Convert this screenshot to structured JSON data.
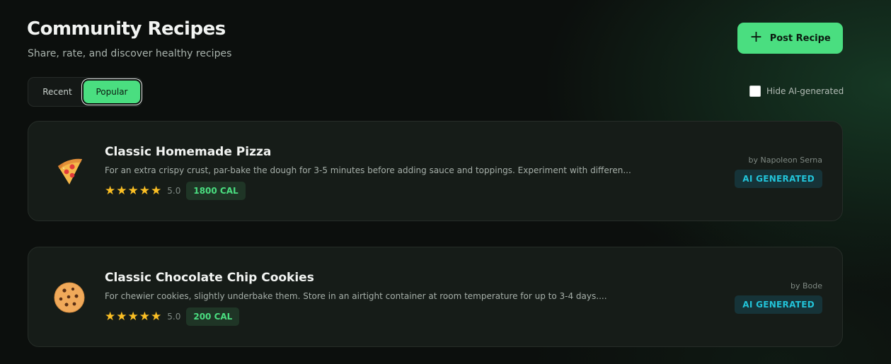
{
  "header": {
    "title": "Community Recipes",
    "subtitle": "Share, rate, and discover healthy recipes",
    "post_button_label": "Post Recipe"
  },
  "tabs": {
    "recent": "Recent",
    "popular": "Popular",
    "active": "Popular"
  },
  "filter": {
    "hide_ai_label": "Hide AI-generated",
    "hide_ai_checked": false
  },
  "recipes": [
    {
      "icon": "pizza-icon",
      "title": "Classic Homemade Pizza",
      "description": "For an extra crispy crust, par-bake the dough for 3-5 minutes before adding sauce and toppings. Experiment with differen...",
      "rating": "5.0",
      "stars": 5,
      "calories": "1800 CAL",
      "author": "by Napoleon Serna",
      "badge": "AI GENERATED"
    },
    {
      "icon": "cookie-icon",
      "title": "Classic Chocolate Chip Cookies",
      "description": "For chewier cookies, slightly underbake them. Store in an airtight container at room temperature for up to 3-4 days....",
      "rating": "5.0",
      "stars": 5,
      "calories": "200 CAL",
      "author": "by Bode",
      "badge": "AI GENERATED"
    }
  ],
  "colors": {
    "accent": "#4ade80",
    "star": "#fbbf24",
    "ai_badge": "#22c3d8",
    "background": "#0c0f0d",
    "card": "#161c18"
  }
}
